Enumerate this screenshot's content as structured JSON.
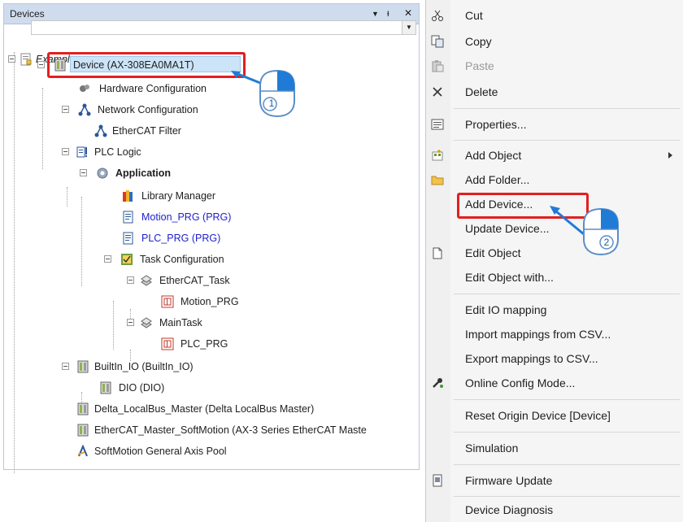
{
  "devices_panel": {
    "title": "Devices",
    "project_name": "Example",
    "tree": {
      "device": "Device (AX-308EA0MA1T)",
      "hardware_configuration": "Hardware Configuration",
      "network_configuration": "Network Configuration",
      "ethercat_filter": "EtherCAT Filter",
      "plc_logic": "PLC Logic",
      "application": "Application",
      "library_manager": "Library Manager",
      "motion_prg": "Motion_PRG (PRG)",
      "plc_prg": "PLC_PRG (PRG)",
      "task_configuration": "Task Configuration",
      "ethercat_task": "EtherCAT_Task",
      "motion_prg_call": "Motion_PRG",
      "main_task": "MainTask",
      "plc_prg_call": "PLC_PRG",
      "builtin_io": "BuiltIn_IO (BuiltIn_IO)",
      "dio": "DIO (DIO)",
      "delta_localbus": "Delta_LocalBus_Master (Delta LocalBus Master)",
      "ethercat_master": "EtherCAT_Master_SoftMotion (AX-3 Series EtherCAT Maste",
      "softmotion_pool": "SoftMotion General Axis Pool"
    }
  },
  "callouts": {
    "step1": "1",
    "step2": "2"
  },
  "context_menu": {
    "cut": "Cut",
    "copy": "Copy",
    "paste": "Paste",
    "delete": "Delete",
    "properties": "Properties...",
    "add_object": "Add Object",
    "add_folder": "Add Folder...",
    "add_device": "Add Device...",
    "update_device": "Update Device...",
    "edit_object": "Edit Object",
    "edit_object_with": "Edit Object with...",
    "edit_io_mapping": "Edit IO mapping",
    "import_mappings": "Import mappings from CSV...",
    "export_mappings": "Export mappings to CSV...",
    "online_config_mode": "Online Config Mode...",
    "reset_origin_device": "Reset Origin Device [Device]",
    "simulation": "Simulation",
    "firmware_update": "Firmware Update",
    "device_diagnosis": "Device Diagnosis"
  },
  "colors": {
    "highlight_red": "#e41f1f",
    "link_blue": "#2020d0",
    "callout_blue": "#1f7bd6"
  }
}
